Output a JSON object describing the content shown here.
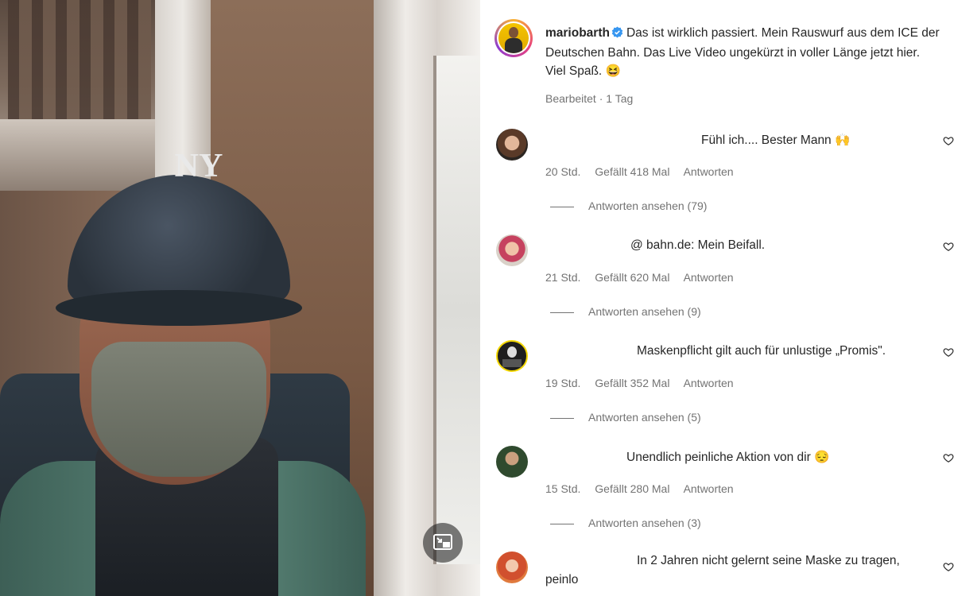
{
  "post": {
    "username": "mariobarth",
    "caption": "Das ist wirklich passiert. Mein Rauswurf aus dem ICE der Deutschen Bahn. Das Live Video ungekürzt in voller Länge jetzt hier. Viel Spaß. 😆",
    "edited": "Bearbeitet",
    "separator": "·",
    "time": "1 Tag"
  },
  "comments": [
    {
      "text": "Fühl ich.... Bester Mann 🙌",
      "time": "20 Std.",
      "likes": "Gefällt 418 Mal",
      "reply": "Antworten",
      "replies": "Antworten ansehen (79)"
    },
    {
      "text": "@ bahn.de: Mein Beifall.",
      "time": "21 Std.",
      "likes": "Gefällt 620 Mal",
      "reply": "Antworten",
      "replies": "Antworten ansehen (9)"
    },
    {
      "text": "Maskenpflicht gilt auch für unlustige „Promis\".",
      "time": "19 Std.",
      "likes": "Gefällt 352 Mal",
      "reply": "Antworten",
      "replies": "Antworten ansehen (5)"
    },
    {
      "text": "Unendlich peinliche Aktion von dir 😔",
      "time": "15 Std.",
      "likes": "Gefällt 280 Mal",
      "reply": "Antworten",
      "replies": "Antworten ansehen (3)"
    }
  ],
  "last_comment": {
    "line1": "In 2 Jahren nicht gelernt seine Maske zu tragen,",
    "line2": "peinlo"
  },
  "video": {
    "cap_logo": "NY"
  },
  "icons": {
    "pip": "picture-in-picture-icon",
    "verified": "verified-badge-icon",
    "heart": "heart-icon"
  },
  "colors": {
    "verified": "#3897f0",
    "meta": "#737373",
    "text": "#262626"
  }
}
